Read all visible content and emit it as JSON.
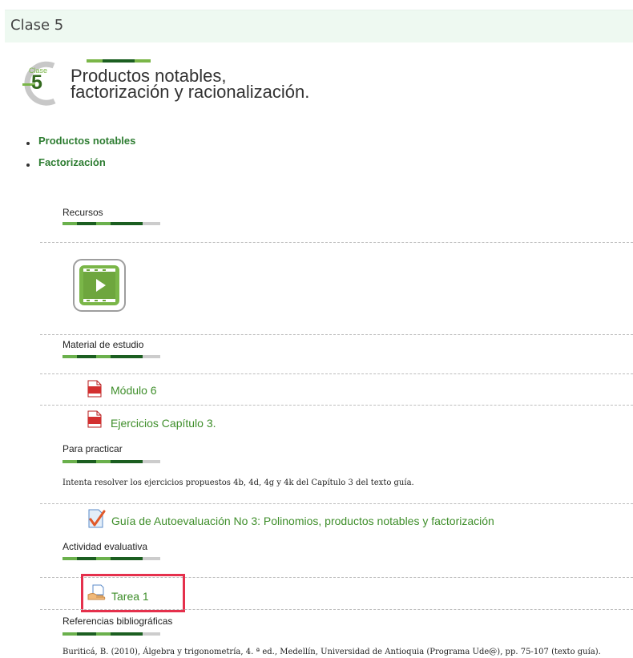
{
  "header": {
    "title": "Clase 5"
  },
  "banner": {
    "clase_word": "Clase",
    "clase_number": "5",
    "title_line1": "Productos notables,",
    "title_line2": "factorización y racionalización."
  },
  "topics": [
    {
      "label": "Productos notables"
    },
    {
      "label": "Factorización"
    }
  ],
  "sections": {
    "recursos": "Recursos",
    "material": "Material de estudio",
    "practicar": "Para practicar",
    "actividad": "Actividad evaluativa",
    "referencias": "Referencias bibliográficas"
  },
  "video": {
    "icon": "video-player-icon"
  },
  "study_files": [
    {
      "label": "Módulo 6",
      "icon": "pdf-icon"
    },
    {
      "label": "Ejercicios Capítulo 3.",
      "icon": "pdf-icon"
    }
  ],
  "practice_text": "Intenta resolver los ejercicios propuestos 4b, 4d, 4g y 4k del Capítulo 3 del texto guía.",
  "quiz": {
    "label": "Guía de Autoevaluación No 3: Polinomios, productos notables y factorización",
    "icon": "quiz-check-icon"
  },
  "assignment": {
    "label": "Tarea 1",
    "icon": "assignment-icon",
    "highlight_color": "#e5304c"
  },
  "reference_text": "Buriticá, B. (2010), Álgebra y trigonometría, 4. ª ed., Medellín, Universidad de Antioquia (Programa Ude@), pp. 75-107 (texto guía)."
}
